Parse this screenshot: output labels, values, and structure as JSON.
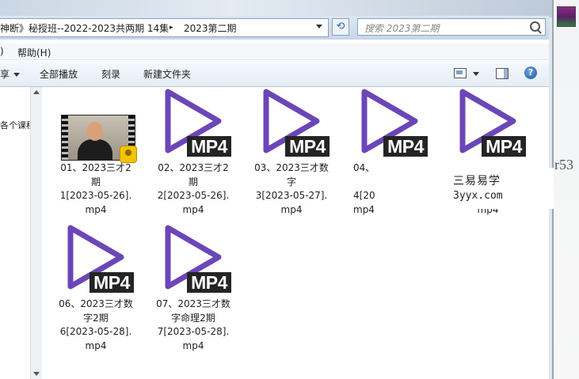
{
  "address_bar": {
    "crumb_1": "神断》秘授班--2022-2023共两期 14集",
    "separator": "▸",
    "crumb_2": "2023第二期"
  },
  "search": {
    "placeholder": "搜索 2023第二期"
  },
  "menu": {
    "item_partial": ")",
    "help": "帮助(H)"
  },
  "toolbar": {
    "organize_partial": "享",
    "play_all": "全部播放",
    "burn": "刻录",
    "new_folder": "新建文件夹"
  },
  "nav_pane": {
    "item_partial": "各个课程"
  },
  "files": [
    {
      "label": "01、2023三才2\n期\n1[2023-05-26].\nmp4",
      "thumbnail": "video-frame"
    },
    {
      "label": "02、2023三才2\n期\n2[2023-05-26].\nmp4",
      "thumbnail": "mp4-play"
    },
    {
      "label": "03、2023三才数\n字\n3[2023-05-27].\nmp4",
      "thumbnail": "mp4-play"
    },
    {
      "label": "04、\n\n4[20\nmp4",
      "thumbnail": "mp4-play"
    },
    {
      "label": "\n\n\nmp4",
      "thumbnail": "mp4-play"
    },
    {
      "label": "06、2023三才数\n字2期\n6[2023-05-28].\nmp4",
      "thumbnail": "mp4-play"
    },
    {
      "label": "07、2023三才数\n字命理2期\n7[2023-05-28].\nmp4",
      "thumbnail": "mp4-play"
    }
  ],
  "mp4_badge": "MP4",
  "watermark": {
    "line1": "三易易学",
    "line2": "3yyx.com"
  },
  "background_text": "r53",
  "colors": {
    "play_icon": "#6b46b8",
    "badge_bg": "#242424"
  }
}
